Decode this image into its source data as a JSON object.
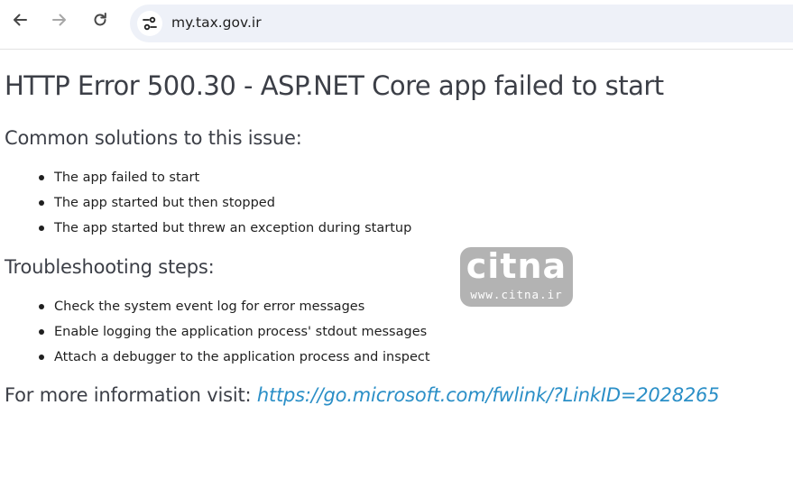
{
  "browser": {
    "url": "my.tax.gov.ir",
    "icons": {
      "back": "back-arrow-icon",
      "forward": "forward-arrow-icon",
      "reload": "reload-icon",
      "site_info": "tune-icon"
    }
  },
  "page": {
    "title": "HTTP Error 500.30 - ASP.NET Core app failed to start",
    "solutions_heading": "Common solutions to this issue:",
    "solutions": [
      "The app failed to start",
      "The app started but then stopped",
      "The app started but threw an exception during startup"
    ],
    "troubleshooting_heading": "Troubleshooting steps:",
    "troubleshooting": [
      "Check the system event log for error messages",
      "Enable logging the application process' stdout messages",
      "Attach a debugger to the application process and inspect"
    ],
    "more_info_prefix": "For more information visit:",
    "more_info_link": "https://go.microsoft.com/fwlink/?LinkID=2028265"
  },
  "watermark": {
    "logo_text": "citna",
    "url": "www.citna.ir"
  },
  "colors": {
    "heading": "#3c3f47",
    "body_text": "#1f1f1f",
    "link": "#2b8fc7",
    "omnibox_bg": "#eef1f8",
    "watermark_bg": "#b3b3b3"
  }
}
